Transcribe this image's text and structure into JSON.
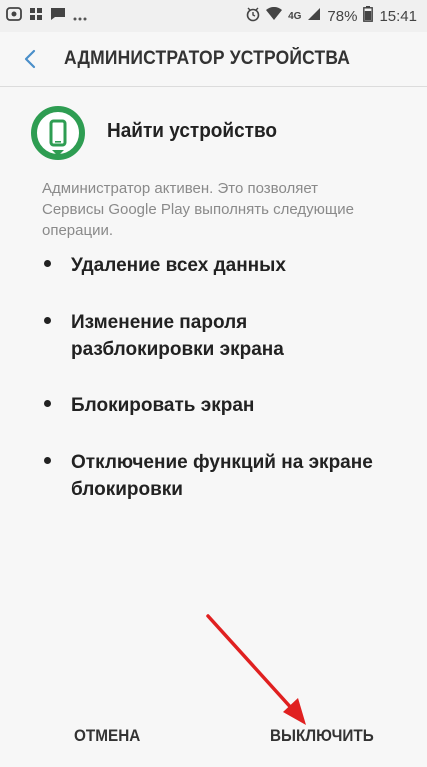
{
  "status_bar": {
    "battery": "78%",
    "time": "15:41",
    "network": "4G"
  },
  "header": {
    "back_icon": "chevron-left-icon",
    "title": "АДМИНИСТРАТОР УСТРОЙСТВА"
  },
  "app": {
    "icon": "find-device-icon",
    "name": "Найти устройство",
    "accent_color": "#2e9d52"
  },
  "description": "Администратор активен. Это позволяет Сервисы Google Play выполнять следующие операции.",
  "permissions": [
    "Удаление всех данных",
    "Изменение пароля разблокировки экрана",
    "Блокировать экран",
    "Отключение функций на экране блокировки"
  ],
  "buttons": {
    "cancel": "ОТМЕНА",
    "disable": "ВЫКЛЮЧИТЬ"
  },
  "annotation": {
    "arrow_color": "#e02020"
  }
}
